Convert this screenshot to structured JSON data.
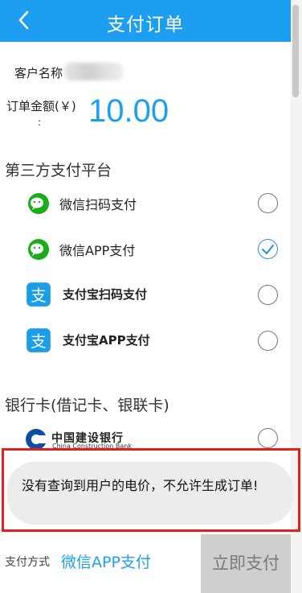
{
  "header": {
    "title": "支付订单"
  },
  "order": {
    "customer_label": "客户名称",
    "amount_label": "订单金额(￥)",
    "amount_colon": ":",
    "amount": "10.00"
  },
  "third_party": {
    "title": "第三方支付平台",
    "options": [
      {
        "label": "微信扫码支付",
        "icon": "wechat-icon",
        "selected": false
      },
      {
        "label": "微信APP支付",
        "icon": "wechat-icon",
        "selected": true
      },
      {
        "label": "支付宝扫码支付",
        "icon": "alipay-icon",
        "selected": false
      },
      {
        "label": "支付宝APP支付",
        "icon": "alipay-icon",
        "selected": false
      }
    ]
  },
  "bank": {
    "title": "银行卡(借记卡、银联卡)",
    "ccb_name_cn": "中国建设银行",
    "ccb_name_en": "China Construction Bank"
  },
  "toast": {
    "message": "没有查询到用户的电价，不允许生成订单!"
  },
  "bottom": {
    "method_label": "支付方式",
    "method_value": "微信APP支付",
    "pay_button": "立即支付"
  },
  "colors": {
    "accent": "#1e9ef0",
    "highlight_frame": "#e0201a",
    "wechat": "#1aad19",
    "alipay": "#1a9ee8"
  }
}
